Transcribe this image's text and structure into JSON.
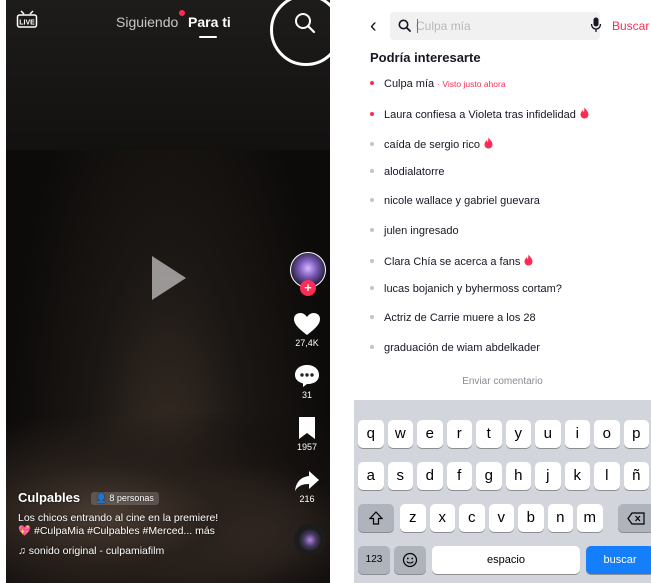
{
  "feed": {
    "live_label": "LIVE",
    "tabs": [
      {
        "label": "Siguiendo",
        "has_dot": true
      },
      {
        "label": "Para ti",
        "active": true
      }
    ],
    "likes": "27,4K",
    "comments": "31",
    "saves": "1957",
    "shares": "216",
    "author": "Culpables",
    "people": "8 personas",
    "description_line1": "Los chicos entrando al cine en la premiere!",
    "description_line2": "💖 #CulpaMia #Culpables #Merced... más",
    "sound": "sonido original - culpamiafilm"
  },
  "search": {
    "back_icon": "chevron-left-icon",
    "placeholder": "Culpa mía",
    "button_label": "Buscar",
    "heading": "Podría interesarte",
    "suggestions": [
      {
        "text": "Culpa mía",
        "visited": "· Visto justo ahora",
        "color": "red"
      },
      {
        "text": "Laura confiesa a Violeta tras infidelidad",
        "trending": true,
        "color": "red"
      },
      {
        "text": "caída de sergio rico",
        "trending": true
      },
      {
        "text": "alodialatorre"
      },
      {
        "text": "nicole wallace y gabriel guevara"
      },
      {
        "text": "julen ingresado"
      },
      {
        "text": "Clara Chía se acerca a fans",
        "trending": true
      },
      {
        "text": "lucas bojanich y byhermoss cortam?"
      },
      {
        "text": "Actriz de Carrie muere a los 28"
      },
      {
        "text": "graduación de wiam abdelkader"
      }
    ],
    "feedback": "Enviar comentario"
  },
  "keyboard": {
    "row1": [
      "q",
      "w",
      "e",
      "r",
      "t",
      "y",
      "u",
      "i",
      "o",
      "p"
    ],
    "row2": [
      "a",
      "s",
      "d",
      "f",
      "g",
      "h",
      "j",
      "k",
      "l",
      "ñ"
    ],
    "row3": [
      "z",
      "x",
      "c",
      "v",
      "b",
      "n",
      "m"
    ],
    "numbers_key": "123",
    "space_key": "espacio",
    "search_key": "buscar"
  },
  "colors": {
    "accent": "#fe2c55",
    "keyboard_blue": "#147efb"
  }
}
